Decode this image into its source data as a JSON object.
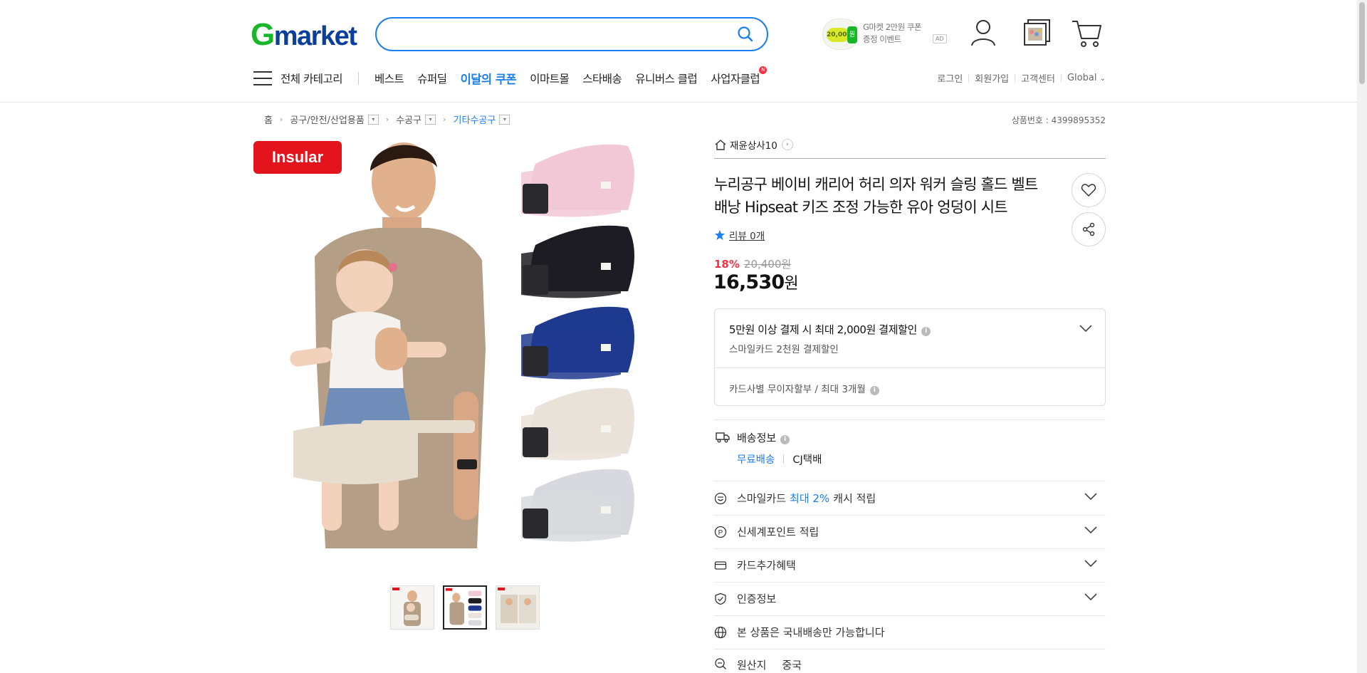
{
  "header": {
    "logo_g": "G",
    "logo_rest": "market",
    "search_placeholder": "",
    "ad": {
      "coin_amount": "20,000",
      "coin_unit": "원",
      "line1": "G마켓 2만원 쿠폰",
      "line2": "증정 이벤트",
      "badge": "AD"
    }
  },
  "nav": {
    "all_categories": "전체 카테고리",
    "items": [
      "베스트",
      "슈퍼딜",
      "이달의 쿠폰",
      "이마트몰",
      "스타배송",
      "유니버스 클럽",
      "사업자클럽"
    ],
    "new_badge": "N",
    "util": [
      "로그인",
      "회원가입",
      "고객센터",
      "Global"
    ],
    "global_caret": "⌄"
  },
  "breadcrumb": {
    "items": [
      "홈",
      "공구/안전/산업용품",
      "수공구",
      "기타수공구"
    ],
    "product_no_label": "상품번호 : 4399895352"
  },
  "product": {
    "brand_logo": "Insular",
    "shop_name": "재윤상사10",
    "title": "누리공구 베이비 캐리어 허리 의자 워커 슬링 홀드 벨트 배낭 Hipseat 키즈 조정 가능한 유아 엉덩이 시트",
    "review_label": "리뷰 0개",
    "discount_pct": "18%",
    "original_price": "20,400원",
    "price": "16,530",
    "price_unit": "원",
    "carrier_colors": [
      "#f2c8d6",
      "#1c1c22",
      "#1e3a8f",
      "#e9e2d8",
      "#d8d9de"
    ],
    "thumbnail_count": 3,
    "selected_thumbnail": 2
  },
  "benefit": {
    "line1": "5만원 이상 결제 시 최대 2,000원 결제할인",
    "line2": "스마일카드 2천원 결제할인",
    "line3": "카드사별 무이자할부 / 최대 3개월"
  },
  "shipping": {
    "label": "배송정보",
    "free": "무료배송",
    "carrier": "CJ택배"
  },
  "rows": {
    "smile_pre": "스마일카드",
    "smile_accent": "최대 2%",
    "smile_post": "캐시 적립",
    "ssg_point": "신세계포인트 적립",
    "card_benefit": "카드추가혜택",
    "cert": "인증정보",
    "domestic": "본 상품은 국내배송만 가능합니다",
    "origin_label": "원산지",
    "origin_value": "중국"
  },
  "colors": {
    "accent_blue": "#1a7ff0",
    "sale_red": "#f43142",
    "logo_green": "#19b62b",
    "logo_navy": "#0b3f9c"
  }
}
